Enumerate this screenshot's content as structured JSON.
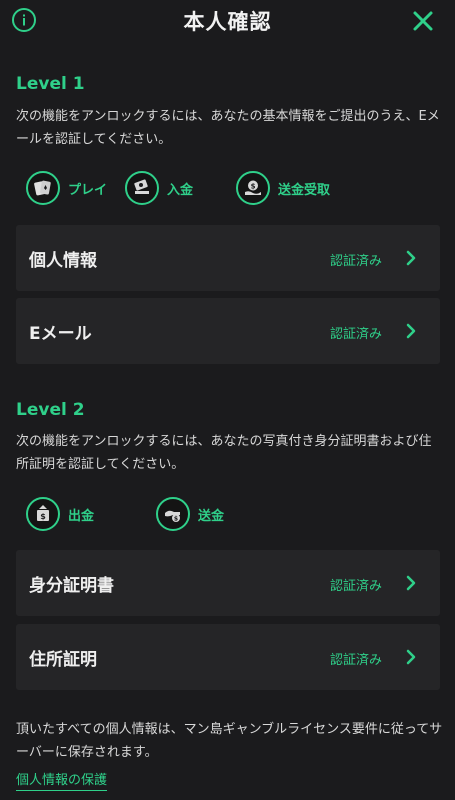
{
  "header": {
    "title": "本人確認"
  },
  "level1": {
    "title": "Level 1",
    "description": "次の機能をアンロックするには、あなたの基本情報をご提出のうえ、Eメールを認証してください。",
    "features": [
      {
        "label": "プレイ",
        "icon": "cards-icon"
      },
      {
        "label": "入金",
        "icon": "deposit-icon"
      },
      {
        "label": "送金受取",
        "icon": "receive-money-icon"
      }
    ],
    "rows": [
      {
        "label": "個人情報",
        "status": "認証済み"
      },
      {
        "label": "Eメール",
        "status": "認証済み"
      }
    ]
  },
  "level2": {
    "title": "Level 2",
    "description": "次の機能をアンロックするには、あなたの写真付き身分証明書および住所証明を認証してください。",
    "features": [
      {
        "label": "出金",
        "icon": "withdraw-icon"
      },
      {
        "label": "送金",
        "icon": "send-money-icon"
      }
    ],
    "rows": [
      {
        "label": "身分証明書",
        "status": "認証済み"
      },
      {
        "label": "住所証明",
        "status": "認証済み"
      }
    ]
  },
  "footer": {
    "text": "頂いたすべての個人情報は、マン島ギャンブルライセンス要件に従ってサーバーに保存されます。",
    "link": "個人情報の保護"
  },
  "colors": {
    "accent": "#2fd08a",
    "background": "#1b1b1d",
    "row": "#252527"
  }
}
